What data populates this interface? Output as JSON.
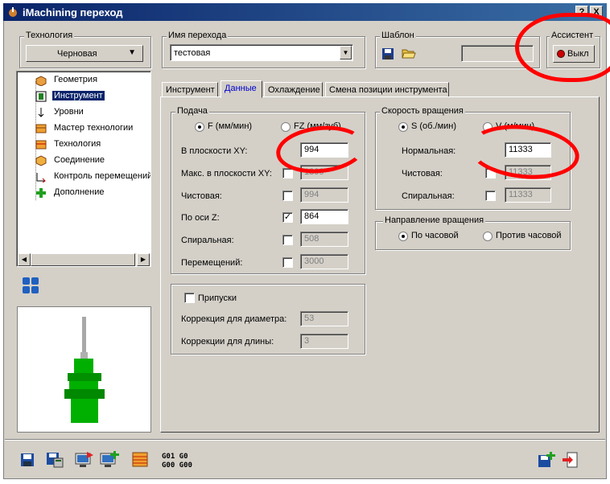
{
  "title": "iMachining переход",
  "title_buttons": {
    "help": "?",
    "close": "X"
  },
  "technology": {
    "label": "Технология",
    "value": "Черновая"
  },
  "operation_name": {
    "label": "Имя перехода",
    "value": "тестовая"
  },
  "template": {
    "label": "Шаблон"
  },
  "assistant": {
    "label": "Ассистент",
    "button": "Выкл"
  },
  "tree": {
    "items": [
      {
        "label": "Геометрия",
        "icon": "geometry-icon"
      },
      {
        "label": "Инструмент",
        "icon": "tool-icon",
        "selected": true
      },
      {
        "label": "Уровни",
        "icon": "levels-icon"
      },
      {
        "label": "Мастер технологии",
        "icon": "technology-wizard-icon"
      },
      {
        "label": "Технология",
        "icon": "technology-icon"
      },
      {
        "label": "Соединение",
        "icon": "link-icon"
      },
      {
        "label": "Контроль перемещений",
        "icon": "motion-control-icon"
      },
      {
        "label": "Дополнение",
        "icon": "misc-icon"
      }
    ]
  },
  "tabs": [
    "Инструмент",
    "Данные",
    "Охлаждение",
    "Смена позиции инструмента"
  ],
  "active_tab": "Данные",
  "feed": {
    "label": "Подача",
    "radio_f": "F (мм/мин)",
    "radio_fz": "FZ (мм/зуб)",
    "rows": [
      {
        "label": "В плоскости XY:",
        "value": "994",
        "checkbox": false,
        "enabled": true
      },
      {
        "label": "Макс. в плоскости XY:",
        "value": "1800",
        "checkbox": false,
        "enabled": false
      },
      {
        "label": "Чистовая:",
        "value": "994",
        "checkbox": false,
        "enabled": false
      },
      {
        "label": "По оси Z:",
        "value": "864",
        "checkbox": true,
        "enabled": true
      },
      {
        "label": "Спиральная:",
        "value": "508",
        "checkbox": false,
        "enabled": false
      },
      {
        "label": "Перемещений:",
        "value": "3000",
        "checkbox": false,
        "enabled": false
      }
    ]
  },
  "spin": {
    "label": "Скорость вращения",
    "radio_s": "S (об./мин)",
    "radio_v": "V (м/мин)",
    "rows": [
      {
        "label": "Нормальная:",
        "value": "11333",
        "enabled": true
      },
      {
        "label": "Чистовая:",
        "value": "11333",
        "checkbox": false,
        "enabled": false
      },
      {
        "label": "Спиральная:",
        "value": "11333",
        "checkbox": false,
        "enabled": false
      }
    ]
  },
  "spin_direction": {
    "label": "Направление вращения",
    "cw": "По часовой",
    "ccw": "Против часовой"
  },
  "allowances": {
    "label": "Припуски",
    "diameter_label": "Коррекция для диаметра:",
    "diameter_value": "53",
    "length_label": "Коррекции для длины:",
    "length_value": "3"
  },
  "gcode_buttons": {
    "line1": "G01 G0",
    "line2": "G00 G00"
  },
  "colors": {
    "accent": "#0a246a",
    "tool_green": "#00b000",
    "annotation_red": "#ff0000"
  }
}
